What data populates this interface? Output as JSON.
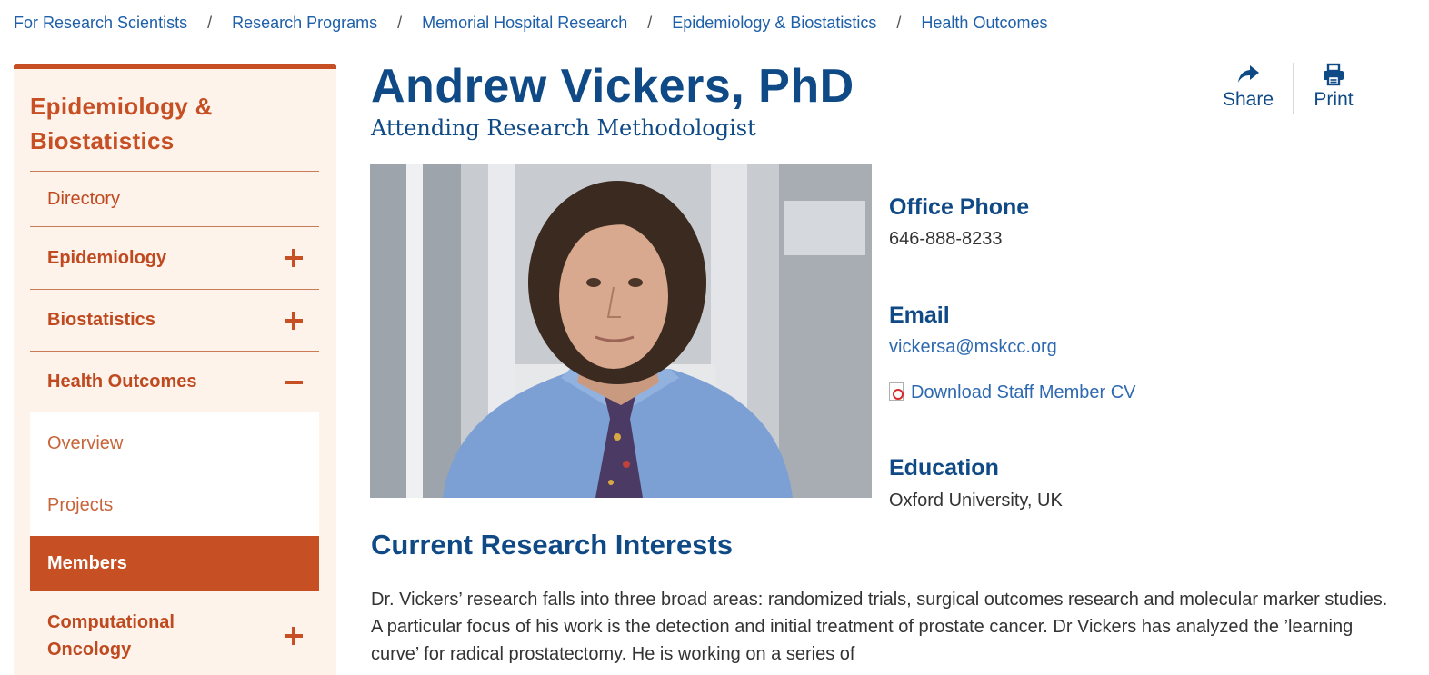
{
  "breadcrumb": [
    "For Research Scientists",
    "Research Programs",
    "Memorial Hospital Research",
    "Epidemiology & Biostatistics",
    "Health Outcomes"
  ],
  "breadcrumb_separator": "/",
  "sidebar": {
    "title": "Epidemiology & Biostatistics",
    "items": {
      "directory": "Directory",
      "epidemiology": "Epidemiology",
      "biostatistics": "Biostatistics",
      "health_outcomes": "Health Outcomes",
      "overview": "Overview",
      "projects": "Projects",
      "members": "Members",
      "computational_oncology": "Computational Oncology"
    },
    "expanded": "Health Outcomes",
    "active": "Members"
  },
  "profile": {
    "name": "Andrew Vickers, PhD",
    "title": "Attending Research Methodologist",
    "photo_alt": "Andrew Vickers portrait"
  },
  "actions": {
    "share": "Share",
    "print": "Print"
  },
  "contact": {
    "phone_label": "Office Phone",
    "phone": "646-888-8233",
    "email_label": "Email",
    "email": "vickersa@mskcc.org",
    "cv_link": "Download Staff Member CV",
    "education_label": "Education",
    "education": "Oxford University, UK"
  },
  "research": {
    "heading": "Current Research Interests",
    "text": "Dr. Vickers’ research falls into three broad areas: randomized trials, surgical outcomes research and molecular marker studies. A particular focus of his work is the detection and initial treatment of prostate cancer. Dr Vickers has analyzed the ’learning curve’ for radical prostatectomy. He is working on a series of"
  },
  "colors": {
    "accent": "#c64f24",
    "brand_blue": "#0f4a86",
    "link_blue": "#1d5fa8",
    "sidebar_bg": "#fdf3eb"
  }
}
